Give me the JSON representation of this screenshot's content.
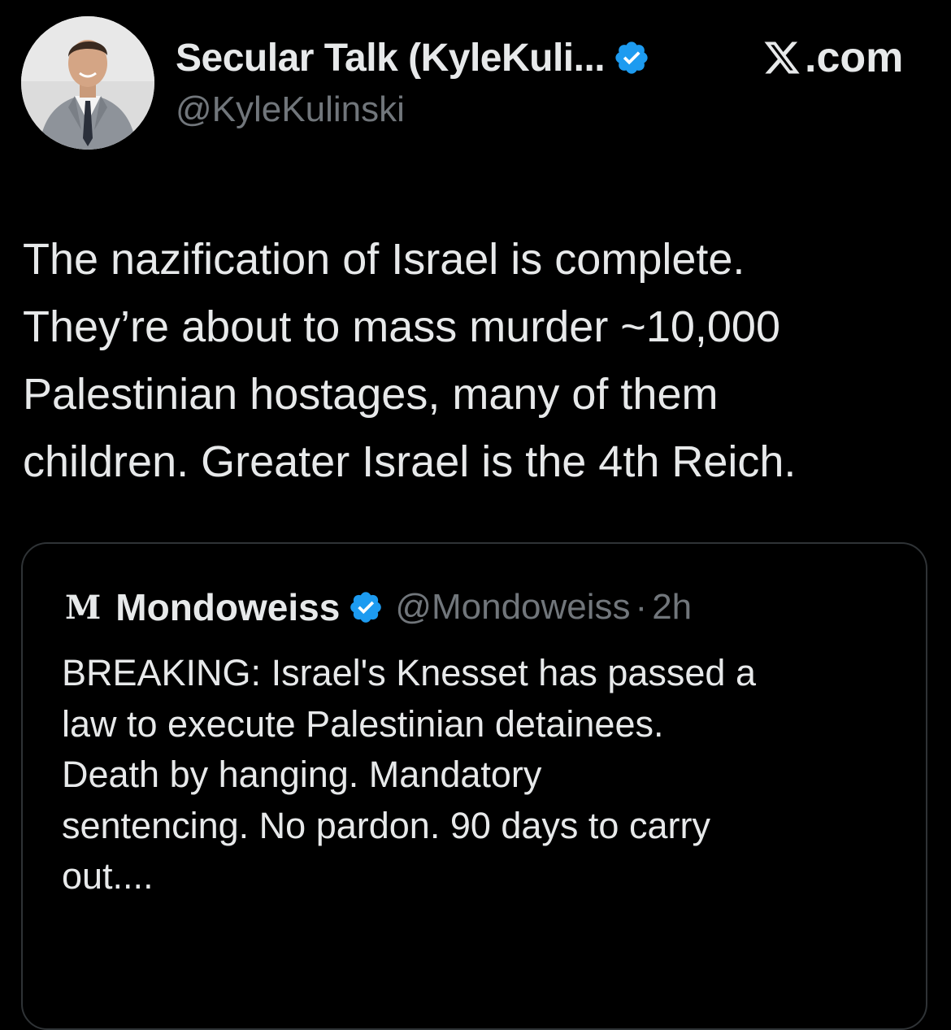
{
  "author": {
    "display_name": "Secular Talk (KyleKuli...",
    "handle": "@KyleKulinski",
    "avatar_icon": "profile-photo",
    "verified_icon": "verified-badge-icon",
    "verified_color": "#1d9bf0"
  },
  "site": {
    "logo_icon": "x-logo-icon",
    "domain": ".com"
  },
  "tweet": {
    "lines": [
      "The nazification of Israel is complete.",
      "They’re about to mass murder ~10,000",
      "Palestinian hostages, many of them",
      "children. Greater Israel is the 4th Reich."
    ]
  },
  "quote": {
    "avatar_letter": "M",
    "name": "Mondoweiss",
    "handle": "@Mondoweiss",
    "separator": "·",
    "time": "2h",
    "lines": [
      "BREAKING: Israel's Knesset has passed a",
      "law to execute Palestinian detainees.",
      "Death by hanging. Mandatory",
      "sentencing. No pardon. 90 days to carry",
      "out...."
    ]
  },
  "colors": {
    "background": "#000000",
    "text_primary": "#e7e9ea",
    "text_secondary": "#71767b",
    "border": "#2f3336"
  }
}
